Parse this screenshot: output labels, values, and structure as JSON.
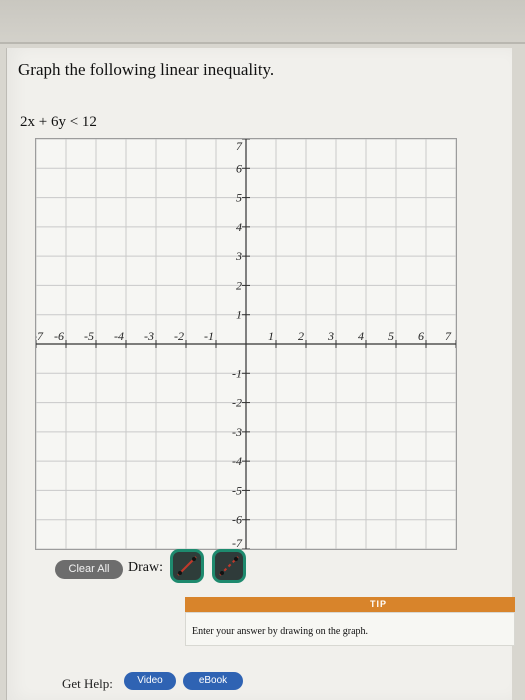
{
  "question": {
    "prompt": "Graph the following linear inequality.",
    "inequality": "2x + 6y < 12"
  },
  "graph": {
    "x_ticks": [
      "-7",
      "-6",
      "-5",
      "-4",
      "-3",
      "-2",
      "-1",
      "1",
      "2",
      "3",
      "4",
      "5",
      "6",
      "7"
    ],
    "y_ticks": [
      "7",
      "6",
      "5",
      "4",
      "3",
      "2",
      "1",
      "-1",
      "-2",
      "-3",
      "-4",
      "-5",
      "-6",
      "-7"
    ],
    "x_range": [
      -7,
      7
    ],
    "y_range": [
      -7,
      7
    ],
    "grid": true
  },
  "controls": {
    "clear_all": "Clear All",
    "draw_label": "Draw:",
    "tools": [
      {
        "name": "solid-line-tool",
        "icon": "solid-line-icon"
      },
      {
        "name": "dashed-line-tool",
        "icon": "dashed-line-icon"
      }
    ]
  },
  "tip": {
    "label": "TIP",
    "text": "Enter your answer by drawing on the graph."
  },
  "help": {
    "label": "Get Help:",
    "video": "Video",
    "ebook": "eBook"
  },
  "colors": {
    "tip_bar": "#d8842b",
    "help_button": "#2f63b3",
    "tool_border": "#1e8a6e",
    "tool_line": "#c0392b"
  }
}
